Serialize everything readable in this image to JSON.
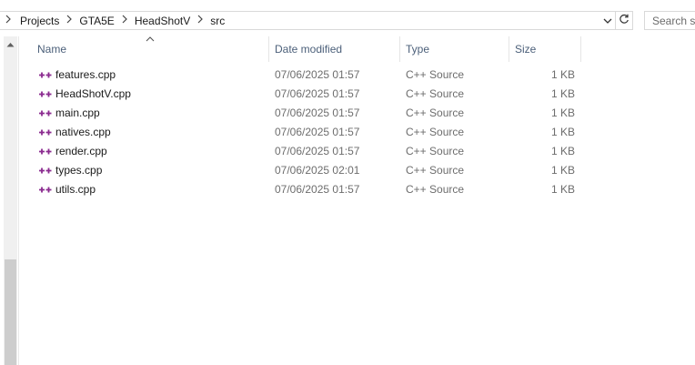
{
  "breadcrumb": {
    "items": [
      "Projects",
      "GTA5E",
      "HeadShotV",
      "src"
    ]
  },
  "search": {
    "placeholder": "Search src"
  },
  "columns": {
    "name": "Name",
    "date": "Date modified",
    "type": "Type",
    "size": "Size"
  },
  "files": [
    {
      "name": "features.cpp",
      "date": "07/06/2025 01:57",
      "type": "C++ Source",
      "size": "1 KB"
    },
    {
      "name": "HeadShotV.cpp",
      "date": "07/06/2025 01:57",
      "type": "C++ Source",
      "size": "1 KB"
    },
    {
      "name": "main.cpp",
      "date": "07/06/2025 01:57",
      "type": "C++ Source",
      "size": "1 KB"
    },
    {
      "name": "natives.cpp",
      "date": "07/06/2025 01:57",
      "type": "C++ Source",
      "size": "1 KB"
    },
    {
      "name": "render.cpp",
      "date": "07/06/2025 01:57",
      "type": "C++ Source",
      "size": "1 KB"
    },
    {
      "name": "types.cpp",
      "date": "07/06/2025 02:01",
      "type": "C++ Source",
      "size": "1 KB"
    },
    {
      "name": "utils.cpp",
      "date": "07/06/2025 01:57",
      "type": "C++ Source",
      "size": "1 KB"
    }
  ],
  "icons": {
    "file": "cpp-file-icon",
    "breadcrumb_separator": "chevron-right-icon",
    "dropdown": "chevron-down-icon",
    "refresh": "refresh-icon",
    "sort": "sort-ascending-icon",
    "scroll_up": "scroll-up-icon"
  },
  "colors": {
    "cpp_icon": "#8a2a8f",
    "header_text": "#4c607a",
    "secondary_text": "#6d6d6d"
  }
}
